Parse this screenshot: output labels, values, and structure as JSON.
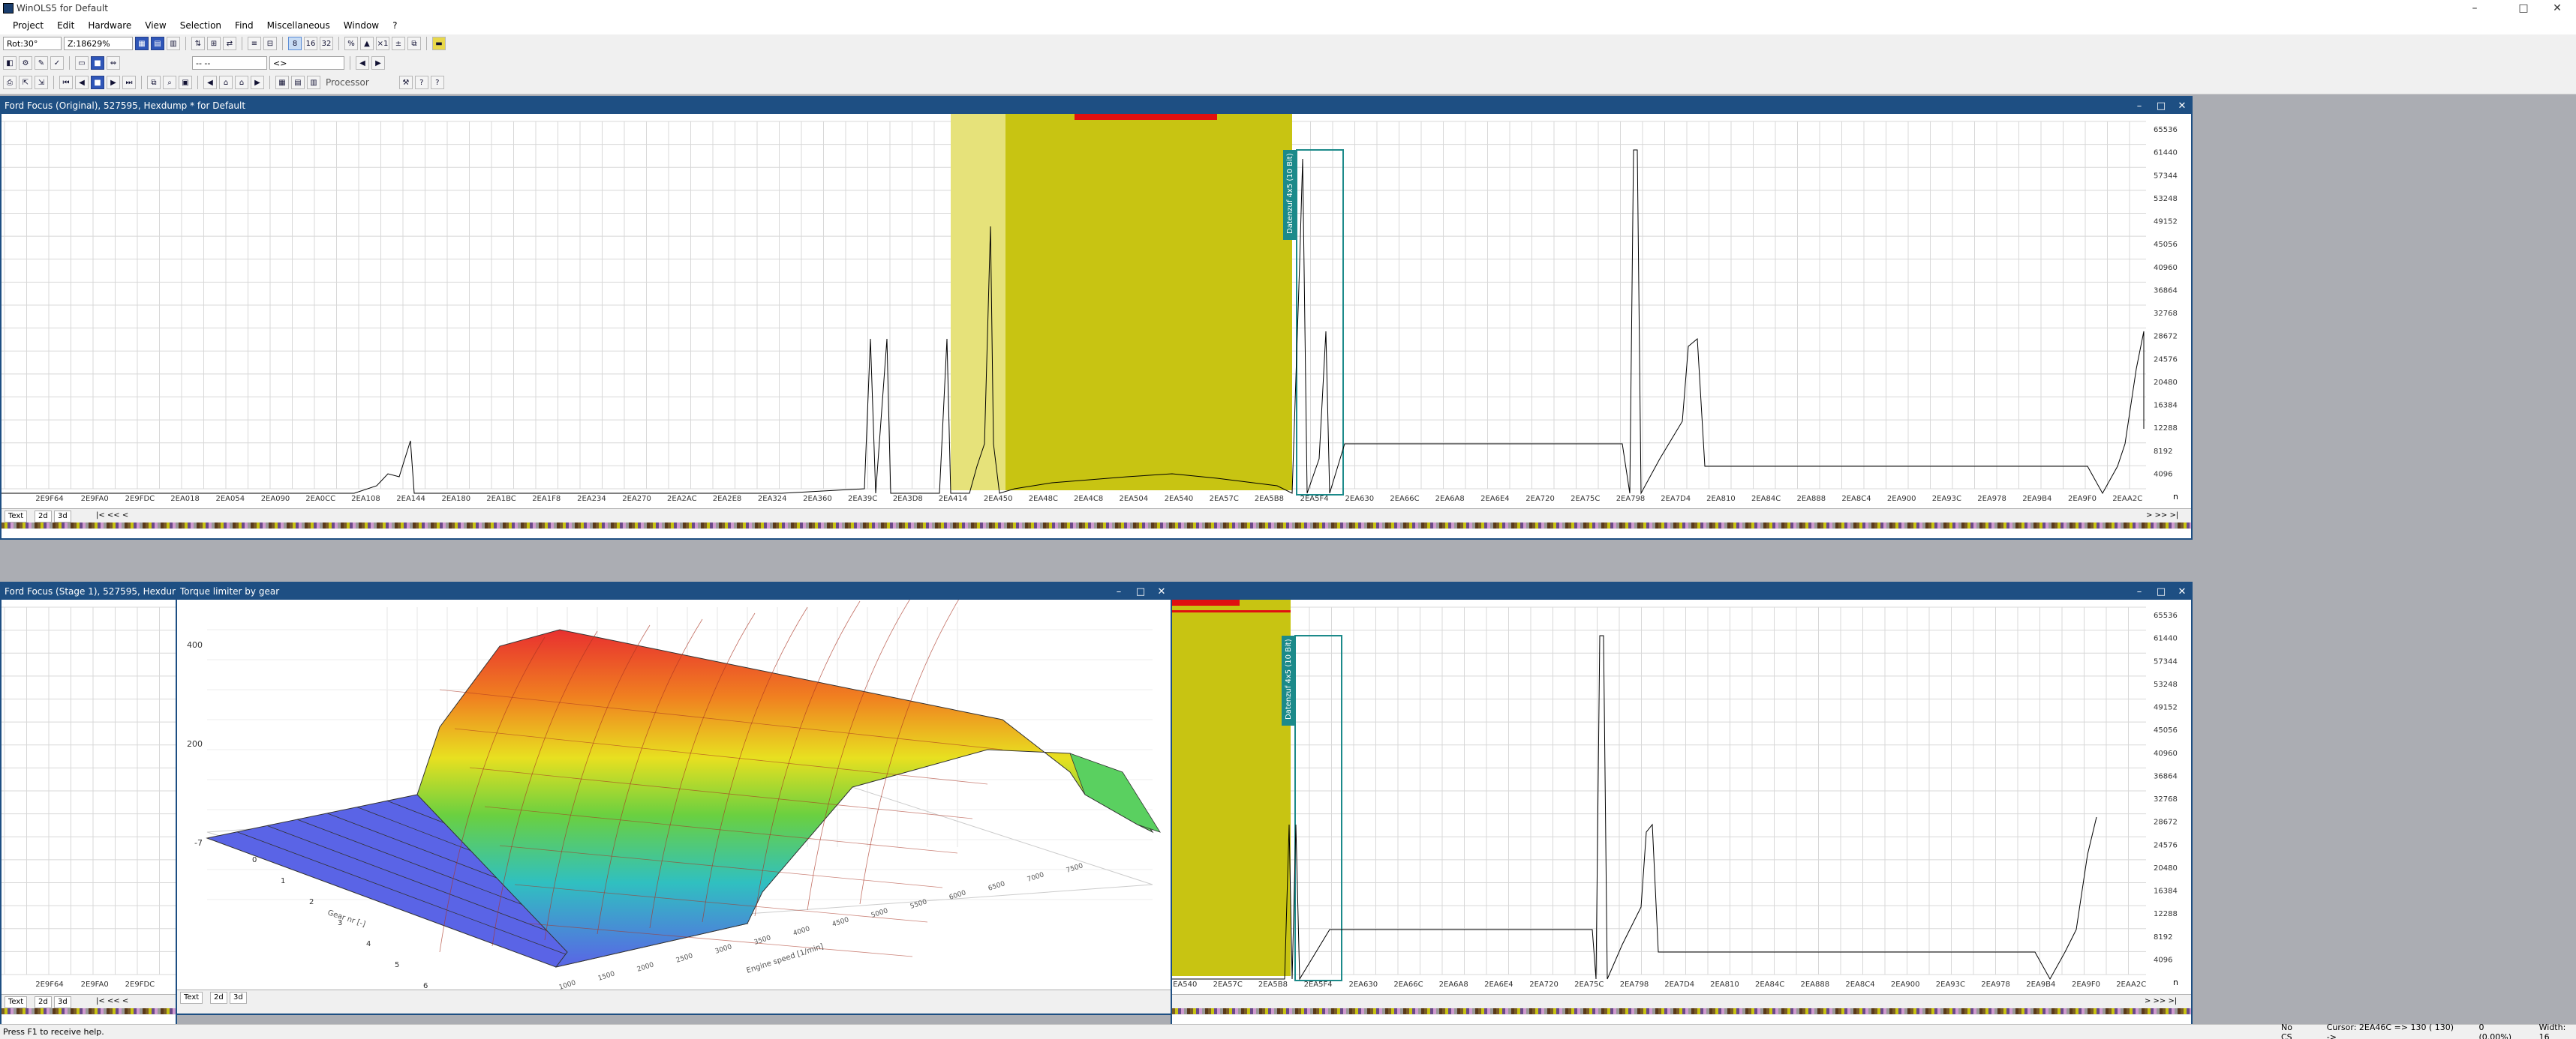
{
  "app": {
    "title": "WinOLS5 for Default",
    "window_controls": {
      "minimize": "–",
      "maximize": "□",
      "close": "✕"
    }
  },
  "menu": [
    "Project",
    "Edit",
    "Hardware",
    "View",
    "Selection",
    "Find",
    "Miscellaneous",
    "Window",
    "?"
  ],
  "toolbar": {
    "rotation": "Rot:30°",
    "zoom": "Z:18629%",
    "dropdown1": "-- --",
    "dropdown2": "<>",
    "processor_label": "Processor"
  },
  "colors": {
    "mdi_title": "#1e4f83",
    "map_selection": "#c8c412",
    "map_selection_light": "#e6e27a",
    "red_marker": "#e01010",
    "teal_box": "#1c8a8a",
    "surface_blue": "#5a64e6"
  },
  "window_top": {
    "title": "Ford Focus (Original), 527595, Hexdump * for Default",
    "y_ticks": [
      "65536",
      "61440",
      "57344",
      "53248",
      "49152",
      "45056",
      "40960",
      "36864",
      "32768",
      "28672",
      "24576",
      "20480",
      "16384",
      "12288",
      "8192",
      "4096"
    ],
    "x_labels": [
      "2E9F64",
      "2E9FA0",
      "2E9FDC",
      "2EA018",
      "2EA054",
      "2EA090",
      "2EA0CC",
      "2EA108",
      "2EA144",
      "2EA180",
      "2EA1BC",
      "2EA1F8",
      "2EA234",
      "2EA270",
      "2EA2AC",
      "2EA2E8",
      "2EA324",
      "2EA360",
      "2EA39C",
      "2EA3D8",
      "2EA414",
      "2EA450",
      "2EA48C",
      "2EA4C8",
      "2EA504",
      "2EA540",
      "2EA57C",
      "2EA5B8",
      "2EA5F4",
      "2EA630",
      "2EA66C",
      "2EA6A8",
      "2EA6E4",
      "2EA720",
      "2EA75C",
      "2EA798",
      "2EA7D4",
      "2EA810",
      "2EA84C",
      "2EA888",
      "2EA8C4",
      "2EA900",
      "2EA93C",
      "2EA978",
      "2EA9B4",
      "2EA9F0",
      "2EAA2C"
    ],
    "tag_label": "Datenzuf 4x5 (10 Bit)",
    "footer_tabs": [
      "Text",
      "2d",
      "3d"
    ],
    "nav": "|< << <",
    "nav_right": "> >> >|",
    "n_marker": "n"
  },
  "window_bottom_left": {
    "title": "Ford Focus (Stage 1), 527595, Hexdum",
    "x_labels": [
      "2E9F64",
      "2E9FA0",
      "2E9FDC"
    ],
    "footer_tabs": [
      "Text",
      "2d",
      "3d"
    ],
    "nav": "|< << <"
  },
  "window_3d": {
    "title": "Torque limiter by gear",
    "z_ticks": [
      "400",
      "200",
      "-7"
    ],
    "gear_axis_label": "Gear nr [-]",
    "gear_ticks": [
      "0",
      "1",
      "2",
      "3",
      "4",
      "5",
      "6"
    ],
    "rpm_axis_label": "Engine speed [1/min]",
    "rpm_ticks": [
      "1000",
      "1500",
      "2000",
      "2500",
      "3000",
      "3500",
      "4000",
      "4500",
      "5000",
      "5500",
      "6000",
      "6500",
      "7000",
      "7500"
    ],
    "footer_tabs": [
      "Text",
      "2d",
      "3d"
    ]
  },
  "window_bottom_right": {
    "x_labels": [
      "2EA540",
      "2EA57C",
      "2EA5B8",
      "2EA5F4",
      "2EA630",
      "2EA66C",
      "2EA6A8",
      "2EA6E4",
      "2EA720",
      "2EA75C",
      "2EA798",
      "2EA7D4",
      "2EA810",
      "2EA84C",
      "2EA888",
      "2EA8C4",
      "2EA900",
      "2EA93C",
      "2EA978",
      "2EA9B4",
      "2EA9F0",
      "2EAA2C"
    ],
    "y_ticks": [
      "65536",
      "61440",
      "57344",
      "53248",
      "49152",
      "45056",
      "40960",
      "36864",
      "32768",
      "28672",
      "24576",
      "20480",
      "16384",
      "12288",
      "8192",
      "4096"
    ],
    "tag_label": "Datenzuf 4x5 (10 Bit)",
    "nav_right": "> >> >|",
    "n_marker": "n"
  },
  "status": {
    "help": "Press F1 to receive help.",
    "cs": "No CS",
    "cursor": "Cursor: 2EA46C => 130 ( 130) ->",
    "percent": "0 (0.00%)",
    "width": "Width: 16"
  }
}
